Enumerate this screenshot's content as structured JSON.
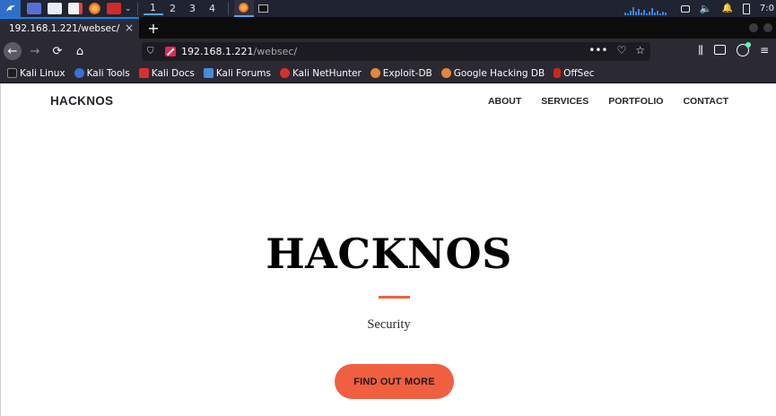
{
  "taskbar": {
    "workspaces": [
      "1",
      "2",
      "3",
      "4"
    ],
    "clock": "7:0",
    "icons": [
      "kali-menu-icon",
      "desktop-icon",
      "file-manager-icon",
      "text-editor-icon",
      "firefox-icon",
      "terminal-icon",
      "chevron-down-icon"
    ]
  },
  "browser": {
    "tab_title": "192.168.1.221/websec/",
    "tab_close": "×",
    "new_tab": "+",
    "url_host": "192.168.1.221",
    "url_path": "/websec/",
    "url_actions": [
      "•••",
      "♡",
      "☆"
    ],
    "bookmarks": [
      "Kali Linux",
      "Kali Tools",
      "Kali Docs",
      "Kali Forums",
      "Kali NetHunter",
      "Exploit-DB",
      "Google Hacking DB",
      "OffSec"
    ]
  },
  "site": {
    "brand": "HACKNOS",
    "nav": [
      "ABOUT",
      "SERVICES",
      "PORTFOLIO",
      "CONTACT"
    ],
    "hero_title": "HACKNOS",
    "hero_subtitle": "Security",
    "cta_label": "FIND OUT MORE"
  },
  "colors": {
    "accent": "#f05f40",
    "taskbar_bg": "#1f2430",
    "browser_chrome": "#2b2a33"
  }
}
